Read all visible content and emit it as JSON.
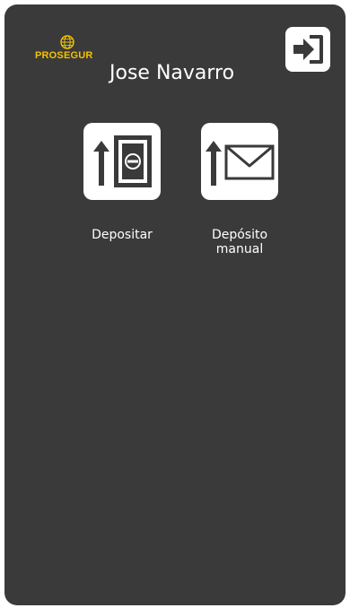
{
  "brand": {
    "logo_text": "PROSEGUR",
    "logo_color": "#f2c300"
  },
  "header": {
    "user_name": "Jose Navarro",
    "logout_icon": "logout-arrow-icon"
  },
  "actions": [
    {
      "label": "Depositar",
      "icon": "deposit-banknote-icon"
    },
    {
      "label_line1": "Depósito",
      "label_line2": "manual",
      "icon": "manual-deposit-envelope-icon"
    }
  ],
  "colors": {
    "background": "#3a3a3a",
    "tile": "#ffffff",
    "icon": "#3a3a3a"
  }
}
